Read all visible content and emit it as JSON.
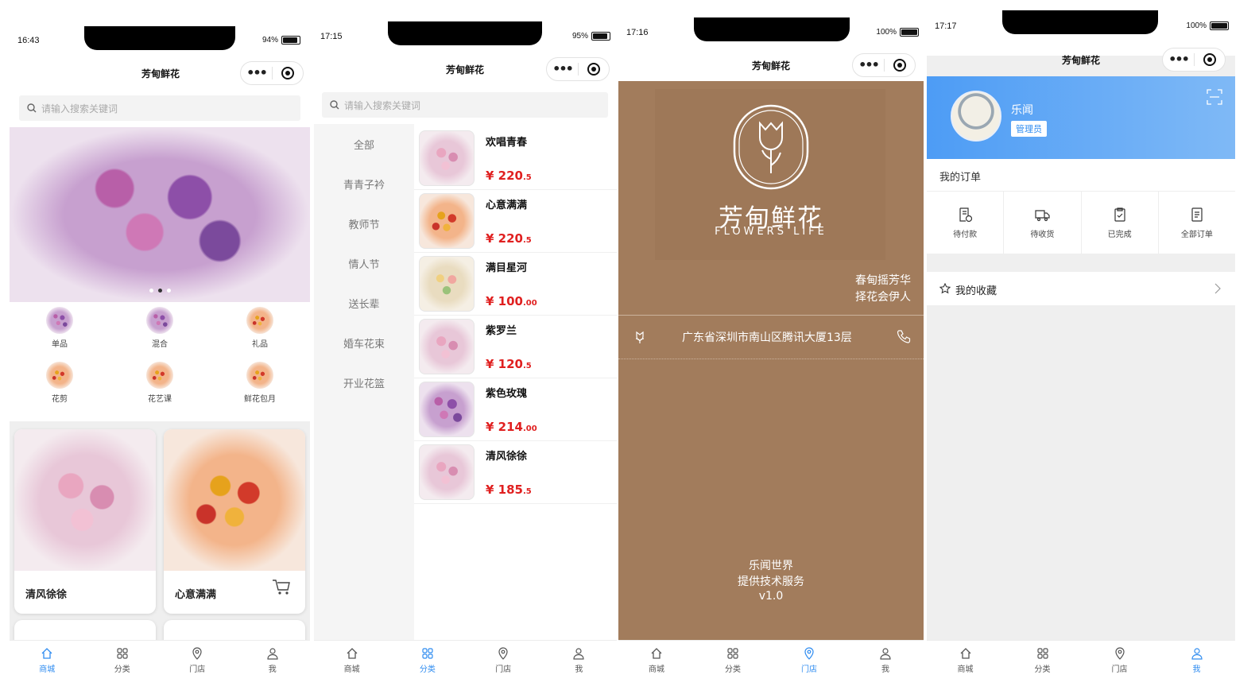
{
  "app_title": "芳甸鲜花",
  "search_placeholder": "请输入搜索关键词",
  "tabs": [
    "商城",
    "分类",
    "门店",
    "我"
  ],
  "accent": "#2f8cf0",
  "price_color": "#e02020",
  "store_bg": "#a27c5c",
  "screens": {
    "home": {
      "time": "16:43",
      "battery": "94%",
      "categories": [
        "单品",
        "混合",
        "礼品",
        "花剪",
        "花艺课",
        "鲜花包月"
      ],
      "cards": [
        "清风徐徐",
        "心意满满"
      ]
    },
    "category": {
      "time": "17:15",
      "battery": "95%",
      "sidebar": [
        "全部",
        "青青子衿",
        "教师节",
        "情人节",
        "送长辈",
        "婚车花束",
        "开业花篮"
      ],
      "products": [
        {
          "name": "欢唱青春",
          "price_int": "¥ 220",
          "price_dec": ".5"
        },
        {
          "name": "心意满满",
          "price_int": "¥ 220",
          "price_dec": ".5"
        },
        {
          "name": "满目星河",
          "price_int": "¥ 100",
          "price_dec": ".00"
        },
        {
          "name": "紫罗兰",
          "price_int": "¥ 120",
          "price_dec": ".5"
        },
        {
          "name": "紫色玫瑰",
          "price_int": "¥ 214",
          "price_dec": ".00"
        },
        {
          "name": "清风徐徐",
          "price_int": "¥ 185",
          "price_dec": ".5"
        }
      ]
    },
    "store": {
      "time": "17:16",
      "battery": "100%",
      "logo_cn": "芳甸鲜花",
      "logo_en": "FLOWERS LIFE",
      "slogan_1": "春甸摇芳华",
      "slogan_2": "择花会伊人",
      "address": "广东省深圳市南山区腾讯大厦13层",
      "footer_1": "乐闻世界",
      "footer_2": "提供技术服务",
      "version": "v1.0"
    },
    "me": {
      "time": "17:17",
      "battery": "100%",
      "user_name": "乐闻",
      "role_badge": "管理员",
      "orders_title": "我的订单",
      "order_items": [
        "待付款",
        "待收货",
        "已完成",
        "全部订单"
      ],
      "favorites": "我的收藏"
    }
  }
}
